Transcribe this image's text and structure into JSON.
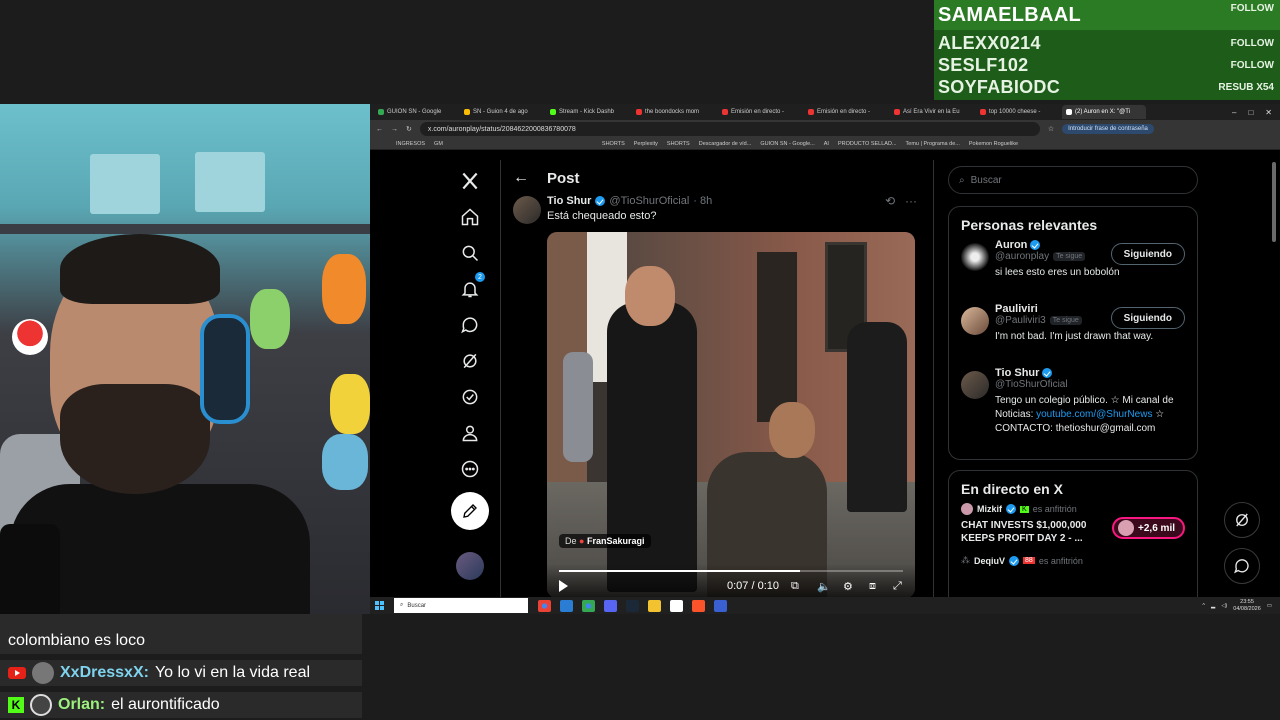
{
  "events": [
    {
      "name": "SAMAELBAAL",
      "action": "FOLLOW"
    },
    {
      "name": "ALEXX0214",
      "action": "FOLLOW"
    },
    {
      "name": "SESLF102",
      "action": "FOLLOW"
    },
    {
      "name": "SOYFABIODC",
      "action": "RESUB X54"
    }
  ],
  "chat": [
    {
      "user": "",
      "text": "colombiano es loco",
      "platform": "youtube"
    },
    {
      "user": "XxDressxX:",
      "text": "Yo lo vi en la vida real",
      "platform": "youtube"
    },
    {
      "user": "Orlan:",
      "text": "el aurontificado",
      "platform": "kick"
    }
  ],
  "browser": {
    "tabs": [
      "GUION SN - Google",
      "SN - Guion 4 de ago",
      "Stream - Kick Dashb",
      "the boondocks mom",
      "Emisión en directo -",
      "Emisión en directo -",
      "Así Era Vivir en la Eu",
      "top 10000 cheese -",
      "(2) Auron en X: \"@Ti"
    ],
    "url": "x.com/auronplay/status/2084622000836780078",
    "password_button": "Introducir frase de contraseña",
    "bookmarks": [
      "INGRESOS",
      "GM",
      "SHORTS",
      "Perplexity",
      "SHORTS",
      "Descargador de víd...",
      "GUION SN - Google...",
      "AI",
      "PRODUCTO SELLAD...",
      "Temu | Programa de...",
      "Pokemon Roguelike"
    ]
  },
  "x": {
    "header_title": "Post",
    "notification_count": "2",
    "tweet": {
      "name": "Tio Shur",
      "handle": "@TioShurOficial",
      "time": "· 8h",
      "text": "Está chequeado esto?",
      "credit_prefix": "De",
      "credit_name": "FranSakuragi",
      "time_label": "0:07 / 0:10",
      "progress": 0.7
    },
    "search_placeholder": "Buscar",
    "relevant_title": "Personas relevantes",
    "people": [
      {
        "name": "Auron",
        "handle": "@auronplay",
        "tag": "Te sigue",
        "button": "Siguiendo",
        "bio": "si lees esto eres un bobolón",
        "bio_link": "",
        "bio_end": ""
      },
      {
        "name": "Pauliviri",
        "handle": "@Pauliviri3",
        "tag": "Te sigue",
        "button": "Siguiendo",
        "bio": "I'm not bad. I'm just drawn that way.",
        "bio_link": "",
        "bio_end": ""
      },
      {
        "name": "Tio Shur",
        "handle": "@TioShurOficial",
        "tag": "",
        "button": "",
        "bio": "Tengo un colegio público. ☆ Mi canal de Noticias: ",
        "bio_link": "youtube.com/@ShurNews",
        "bio_end": " ☆ CONTACTO: thetioshur@gmail.com"
      }
    ],
    "live_title": "En directo en X",
    "live": [
      {
        "host": "Mizkif",
        "host_suffix": "es anfitrión",
        "title": "CHAT INVESTS $1,000,000 KEEPS PROFIT DAY 2 - ...",
        "count": "+2,6 mil"
      },
      {
        "host": "DeqiuV",
        "host_suffix": "es anfitrión",
        "title": "",
        "count": ""
      }
    ]
  },
  "taskbar": {
    "search_placeholder": "Buscar",
    "time": "23:55",
    "date": "04/08/2026"
  }
}
